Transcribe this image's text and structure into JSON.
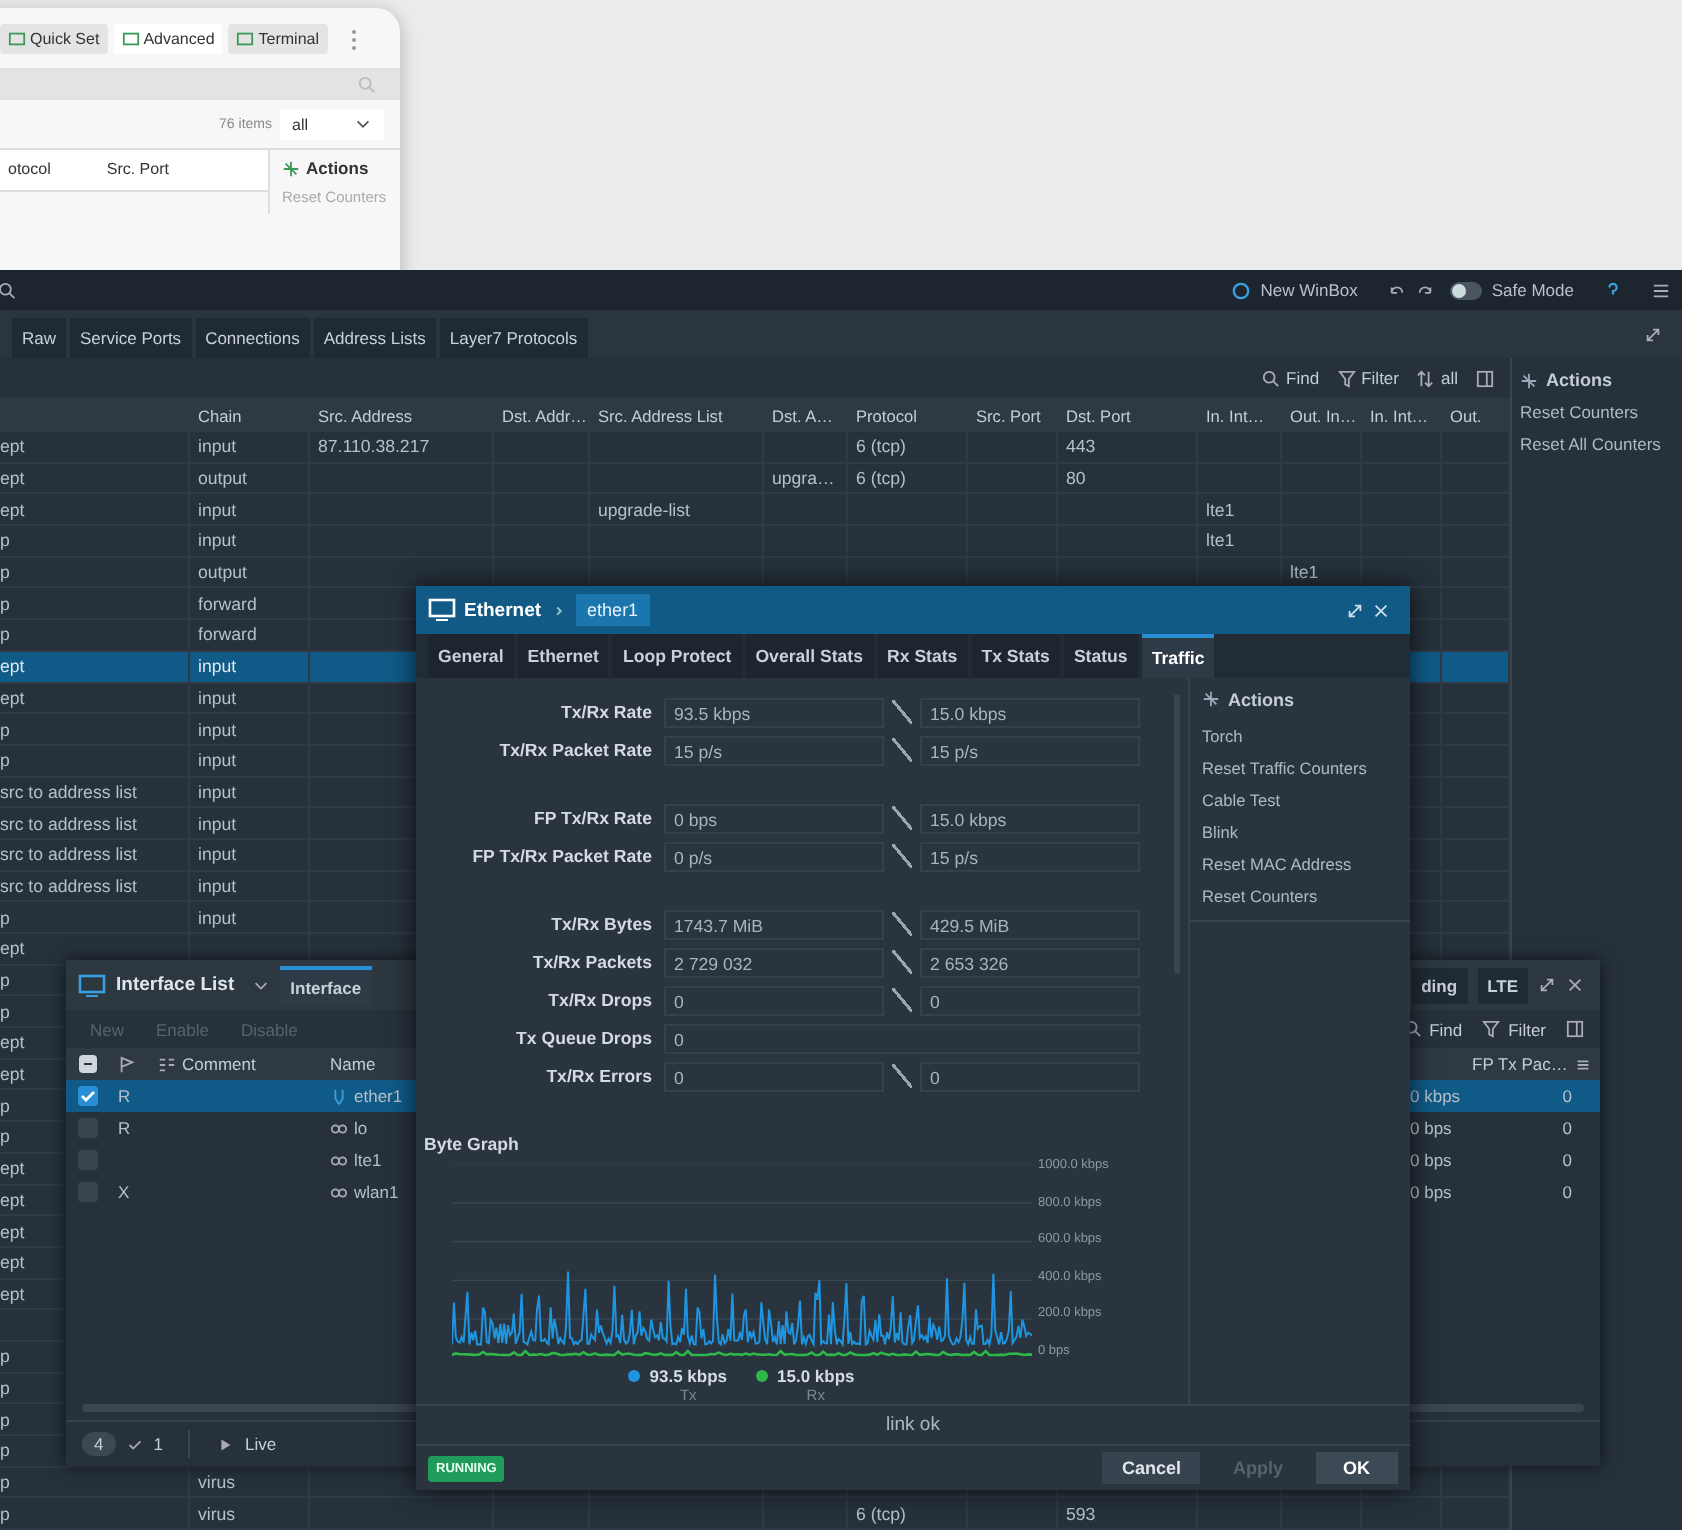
{
  "bg_window": {
    "toolbar": [
      {
        "label": "Quick Set",
        "selected": false
      },
      {
        "label": "Advanced",
        "selected": true
      },
      {
        "label": "Terminal",
        "selected": false
      }
    ],
    "items_count": "76 items",
    "scope": "all",
    "columns": [
      "otocol",
      "Src. Port"
    ],
    "actions_title": "Actions",
    "actions": [
      "Reset Counters"
    ]
  },
  "main": {
    "topbar": {
      "new_winbox": "New WinBox",
      "safe_mode": "Safe Mode",
      "safe_mode_on": false
    },
    "tabs": [
      {
        "label": "Raw",
        "selected": false
      },
      {
        "label": "Service Ports",
        "selected": false
      },
      {
        "label": "Connections",
        "selected": false
      },
      {
        "label": "Address Lists",
        "selected": false
      },
      {
        "label": "Layer7 Protocols",
        "selected": false
      }
    ],
    "toolbar": {
      "find": "Find",
      "filter": "Filter",
      "scope": "all"
    },
    "columns": [
      null,
      "Chain",
      "Src. Address",
      "Dst. Addr…",
      "Src. Address List",
      "Dst. A…",
      "Protocol",
      "Src. Port",
      "Dst. Port",
      "In. Int…",
      "Out. In…",
      "In. Int…",
      "Out."
    ],
    "rows": [
      {
        "selected": false,
        "cells": [
          "ept",
          "input",
          "87.110.38.217",
          null,
          null,
          null,
          "6 (tcp)",
          null,
          "443"
        ]
      },
      {
        "selected": false,
        "cells": [
          "ept",
          "output",
          null,
          null,
          null,
          "upgra…",
          "6 (tcp)",
          null,
          "80"
        ]
      },
      {
        "selected": false,
        "cells": [
          "ept",
          "input",
          null,
          null,
          "upgrade-list",
          null,
          null,
          null,
          null,
          "lte1"
        ]
      },
      {
        "selected": false,
        "cells": [
          "p",
          "input",
          null,
          null,
          null,
          null,
          null,
          null,
          null,
          "lte1"
        ]
      },
      {
        "selected": false,
        "cells": [
          "p",
          "output",
          null,
          null,
          null,
          null,
          null,
          null,
          null,
          null,
          "lte1"
        ]
      },
      {
        "selected": false,
        "cells": [
          "p",
          "forward"
        ]
      },
      {
        "selected": false,
        "cells": [
          "p",
          "forward"
        ]
      },
      {
        "selected": true,
        "cells": [
          "ept",
          "input"
        ]
      },
      {
        "selected": false,
        "cells": [
          "ept",
          "input"
        ]
      },
      {
        "selected": false,
        "cells": [
          "p",
          "input"
        ]
      },
      {
        "selected": false,
        "cells": [
          "p",
          "input"
        ]
      },
      {
        "selected": false,
        "cells": [
          "src to address list",
          "input"
        ]
      },
      {
        "selected": false,
        "cells": [
          "src to address list",
          "input"
        ]
      },
      {
        "selected": false,
        "cells": [
          "src to address list",
          "input"
        ]
      },
      {
        "selected": false,
        "cells": [
          "src to address list",
          "input"
        ]
      },
      {
        "selected": false,
        "cells": [
          "p",
          "input"
        ]
      },
      {
        "selected": false,
        "cells": [
          "ept"
        ]
      },
      {
        "selected": false,
        "cells": [
          "p"
        ]
      },
      {
        "selected": false,
        "cells": [
          "p"
        ]
      },
      {
        "selected": false,
        "cells": [
          "ept"
        ]
      },
      {
        "selected": false,
        "cells": [
          "ept"
        ]
      },
      {
        "selected": false,
        "cells": [
          "p"
        ]
      },
      {
        "selected": false,
        "cells": [
          "p"
        ]
      },
      {
        "selected": false,
        "cells": [
          "ept"
        ]
      },
      {
        "selected": false,
        "cells": [
          "ept"
        ]
      },
      {
        "selected": false,
        "cells": [
          "ept"
        ]
      },
      {
        "selected": false,
        "cells": [
          "ept"
        ]
      },
      {
        "selected": false,
        "cells": [
          "ept"
        ]
      },
      {
        "selected": false,
        "cells": [
          null
        ]
      },
      {
        "selected": false,
        "cells": [
          "p"
        ]
      },
      {
        "selected": false,
        "cells": [
          "p"
        ]
      },
      {
        "selected": false,
        "cells": [
          "p"
        ]
      },
      {
        "selected": false,
        "cells": [
          "p"
        ]
      },
      {
        "selected": false,
        "cells": [
          "p",
          "virus"
        ]
      },
      {
        "selected": false,
        "cells": [
          "p",
          "virus",
          null,
          null,
          null,
          null,
          "6 (tcp)",
          null,
          "593"
        ]
      }
    ],
    "actions_title": "Actions",
    "actions": [
      "Reset Counters",
      "Reset All Counters"
    ]
  },
  "interface_list": {
    "title": "Interface List",
    "tabs_left": [
      {
        "label": "Interface",
        "selected": true
      }
    ],
    "tabs_right": [
      {
        "label": "ding",
        "selected": false
      },
      {
        "label": "LTE",
        "selected": false
      }
    ],
    "toolbar": [
      {
        "label": "New",
        "disabled": true
      },
      {
        "label": "Enable",
        "disabled": true
      },
      {
        "label": "Disable",
        "disabled": true
      }
    ],
    "find": "Find",
    "filter": "Filter",
    "columns": {
      "comment": "Comment",
      "name": "Name",
      "fp_tx": "FP Tx Pac…"
    },
    "rows": [
      {
        "checked": true,
        "selected": true,
        "flag": "R",
        "kind": "ethernet",
        "name": "ether1",
        "rate": "0 kbps",
        "fp_tx": "0"
      },
      {
        "checked": false,
        "selected": false,
        "flag": "R",
        "kind": "virtual",
        "name": "lo",
        "rate": "0 bps",
        "fp_tx": "0"
      },
      {
        "checked": false,
        "selected": false,
        "kind": "virtual",
        "name": "lte1",
        "rate": "0 bps",
        "fp_tx": "0"
      },
      {
        "checked": false,
        "selected": false,
        "flag": "X",
        "kind": "virtual",
        "name": "wlan1",
        "rate": "0 bps",
        "fp_tx": "0"
      }
    ],
    "count": "4",
    "selected_count": "1",
    "live": "Live"
  },
  "dialog": {
    "title": "Ethernet",
    "item": "ether1",
    "tabs": [
      {
        "label": "General",
        "selected": false
      },
      {
        "label": "Ethernet",
        "selected": false
      },
      {
        "label": "Loop Protect",
        "selected": false
      },
      {
        "label": "Overall Stats",
        "selected": false
      },
      {
        "label": "Rx Stats",
        "selected": false
      },
      {
        "label": "Tx Stats",
        "selected": false
      },
      {
        "label": "Status",
        "selected": false
      },
      {
        "label": "Traffic",
        "selected": true
      }
    ],
    "field_groups": [
      [
        {
          "kind": "pair",
          "label": "Tx/Rx Rate",
          "tx": "93.5 kbps",
          "rx": "15.0 kbps"
        },
        {
          "kind": "pair",
          "label": "Tx/Rx Packet Rate",
          "tx": "15 p/s",
          "rx": "15 p/s"
        }
      ],
      [
        {
          "kind": "pair",
          "label": "FP Tx/Rx Rate",
          "tx": "0 bps",
          "rx": "15.0 kbps"
        },
        {
          "kind": "pair",
          "label": "FP Tx/Rx Packet Rate",
          "tx": "0 p/s",
          "rx": "15 p/s"
        }
      ],
      [
        {
          "kind": "pair",
          "label": "Tx/Rx Bytes",
          "tx": "1743.7 MiB",
          "rx": "429.5 MiB"
        },
        {
          "kind": "pair",
          "label": "Tx/Rx Packets",
          "tx": "2 729 032",
          "rx": "2 653 326"
        },
        {
          "kind": "pair",
          "label": "Tx/Rx Drops",
          "tx": "0",
          "rx": "0"
        },
        {
          "kind": "single",
          "label": "Tx Queue Drops",
          "tx": "0"
        },
        {
          "kind": "pair",
          "label": "Tx/Rx Errors",
          "tx": "0",
          "rx": "0"
        }
      ]
    ],
    "graph_title": "Byte Graph",
    "y_labels": [
      "1000.0 kbps",
      "800.0 kbps",
      "600.0 kbps",
      "400.0 kbps",
      "200.0 kbps",
      "0 bps"
    ],
    "legend": [
      {
        "value": "93.5 kbps",
        "label": "Tx",
        "color": "#1e95e0"
      },
      {
        "value": "15.0 kbps",
        "label": "Rx",
        "color": "#2fb84a"
      }
    ],
    "actions_title": "Actions",
    "actions": [
      "Torch",
      "Reset Traffic Counters",
      "Cable Test",
      "Blink",
      "Reset MAC Address",
      "Reset Counters"
    ],
    "status": "link ok",
    "running": "RUNNING",
    "buttons": [
      {
        "label": "Cancel",
        "kind": "secondary",
        "disabled": false
      },
      {
        "label": "Apply",
        "kind": "secondary",
        "disabled": true
      },
      {
        "label": "OK",
        "kind": "primary",
        "disabled": false
      }
    ]
  }
}
